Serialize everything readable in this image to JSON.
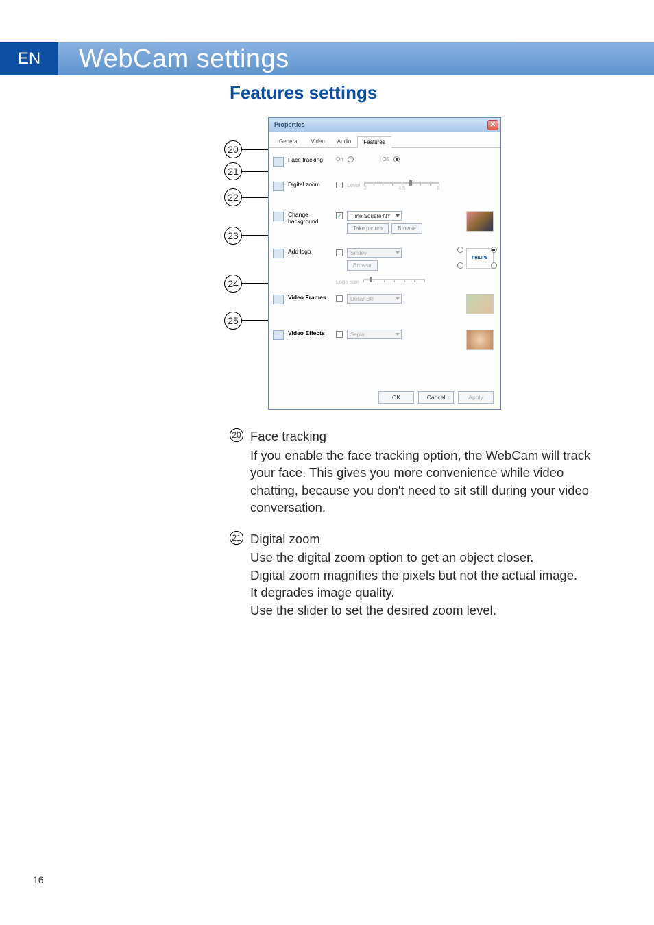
{
  "page": {
    "lang": "EN",
    "number": "16"
  },
  "header": {
    "title": "WebCam settings"
  },
  "section": {
    "title": "Features settings"
  },
  "callouts": [
    "20",
    "21",
    "22",
    "23",
    "24",
    "25"
  ],
  "dialog": {
    "title": "Properties",
    "tabs": {
      "general": "General",
      "video": "Video",
      "audio": "Audio",
      "features": "Features"
    },
    "rows": {
      "face": {
        "label": "Face tracking",
        "on": "On",
        "off": "Off"
      },
      "zoom": {
        "label": "Digital zoom",
        "level": "Level",
        "min": "2",
        "mid": "4.5",
        "max": "8"
      },
      "bg": {
        "label": "Change background",
        "dd": "Time Square NY",
        "take": "Take picture",
        "browse": "Browse"
      },
      "logo": {
        "label": "Add logo",
        "dd": "Smiley",
        "browse": "Browse",
        "logosize": "Logo size"
      },
      "frames": {
        "label": "Video Frames",
        "dd": "Dollar Bill"
      },
      "effects": {
        "label": "Video Effects",
        "dd": "Sepia"
      },
      "philips": "PHILIPS"
    },
    "foot": {
      "ok": "OK",
      "cancel": "Cancel",
      "apply": "Apply"
    }
  },
  "body": {
    "s20": {
      "num": "20",
      "head": "Face tracking",
      "text": "If you enable the face tracking option, the WebCam will track your face. This gives you more convenience while video chatting, because you don't need to sit still during your video conversation."
    },
    "s21": {
      "num": "21",
      "head": "Digital zoom",
      "l1": "Use the digital zoom option to get an object closer.",
      "l2": "Digital zoom magnifies the pixels but not the actual image.",
      "l3": "It degrades image quality.",
      "l4": "Use the slider to set the desired zoom level."
    }
  }
}
